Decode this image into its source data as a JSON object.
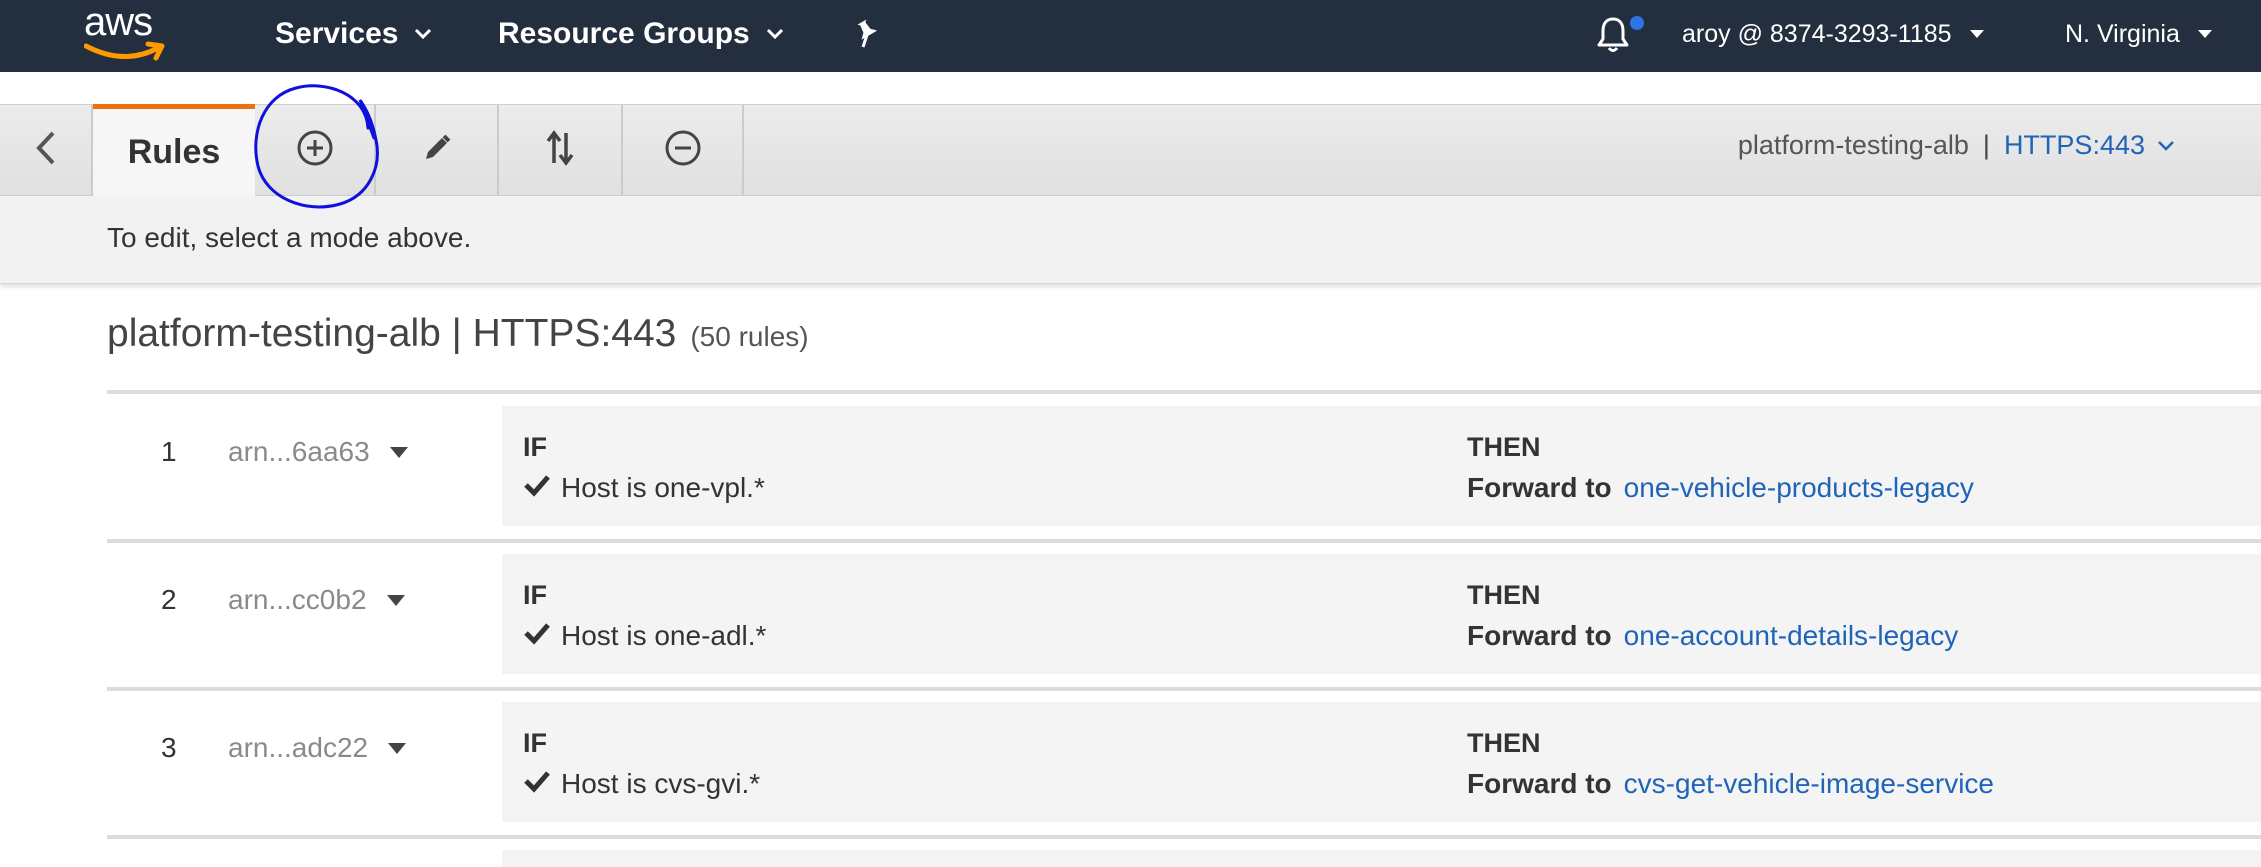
{
  "topnav": {
    "logo": "aws",
    "services_label": "Services",
    "resource_groups_label": "Resource Groups",
    "account_label": "aroy @ 8374-3293-1185",
    "region_label": "N. Virginia",
    "icons": [
      "chevron-down-icon",
      "pin-icon",
      "bell-icon",
      "caret-down-icon"
    ]
  },
  "modebar": {
    "back_icon": "chevron-left-icon",
    "rules_tab_label": "Rules",
    "mode_icons": [
      "plus-circle-icon",
      "pencil-icon",
      "sort-arrows-icon",
      "minus-circle-icon"
    ],
    "listener_name": "platform-testing-alb",
    "listener_separator": "|",
    "listener_protocol": "HTTPS:443"
  },
  "hint": "To edit, select a mode above.",
  "heading": {
    "title": "platform-testing-alb | HTTPS:443",
    "count": "(50 rules)"
  },
  "rules": [
    {
      "number": "1",
      "arn": "arn...6aa63",
      "if_label": "IF",
      "condition": "Host is one-vpl.*",
      "then_label": "THEN",
      "action_label": "Forward to",
      "target": "one-vehicle-products-legacy"
    },
    {
      "number": "2",
      "arn": "arn...cc0b2",
      "if_label": "IF",
      "condition": "Host is one-adl.*",
      "then_label": "THEN",
      "action_label": "Forward to",
      "target": "one-account-details-legacy"
    },
    {
      "number": "3",
      "arn": "arn...adc22",
      "if_label": "IF",
      "condition": "Host is cvs-gvi.*",
      "then_label": "THEN",
      "action_label": "Forward to",
      "target": "cvs-get-vehicle-image-service"
    }
  ],
  "colors": {
    "nav_bg": "#232f3e",
    "tab_accent": "#ec7211",
    "link": "#1f64b8",
    "annotation": "#1010dd"
  }
}
